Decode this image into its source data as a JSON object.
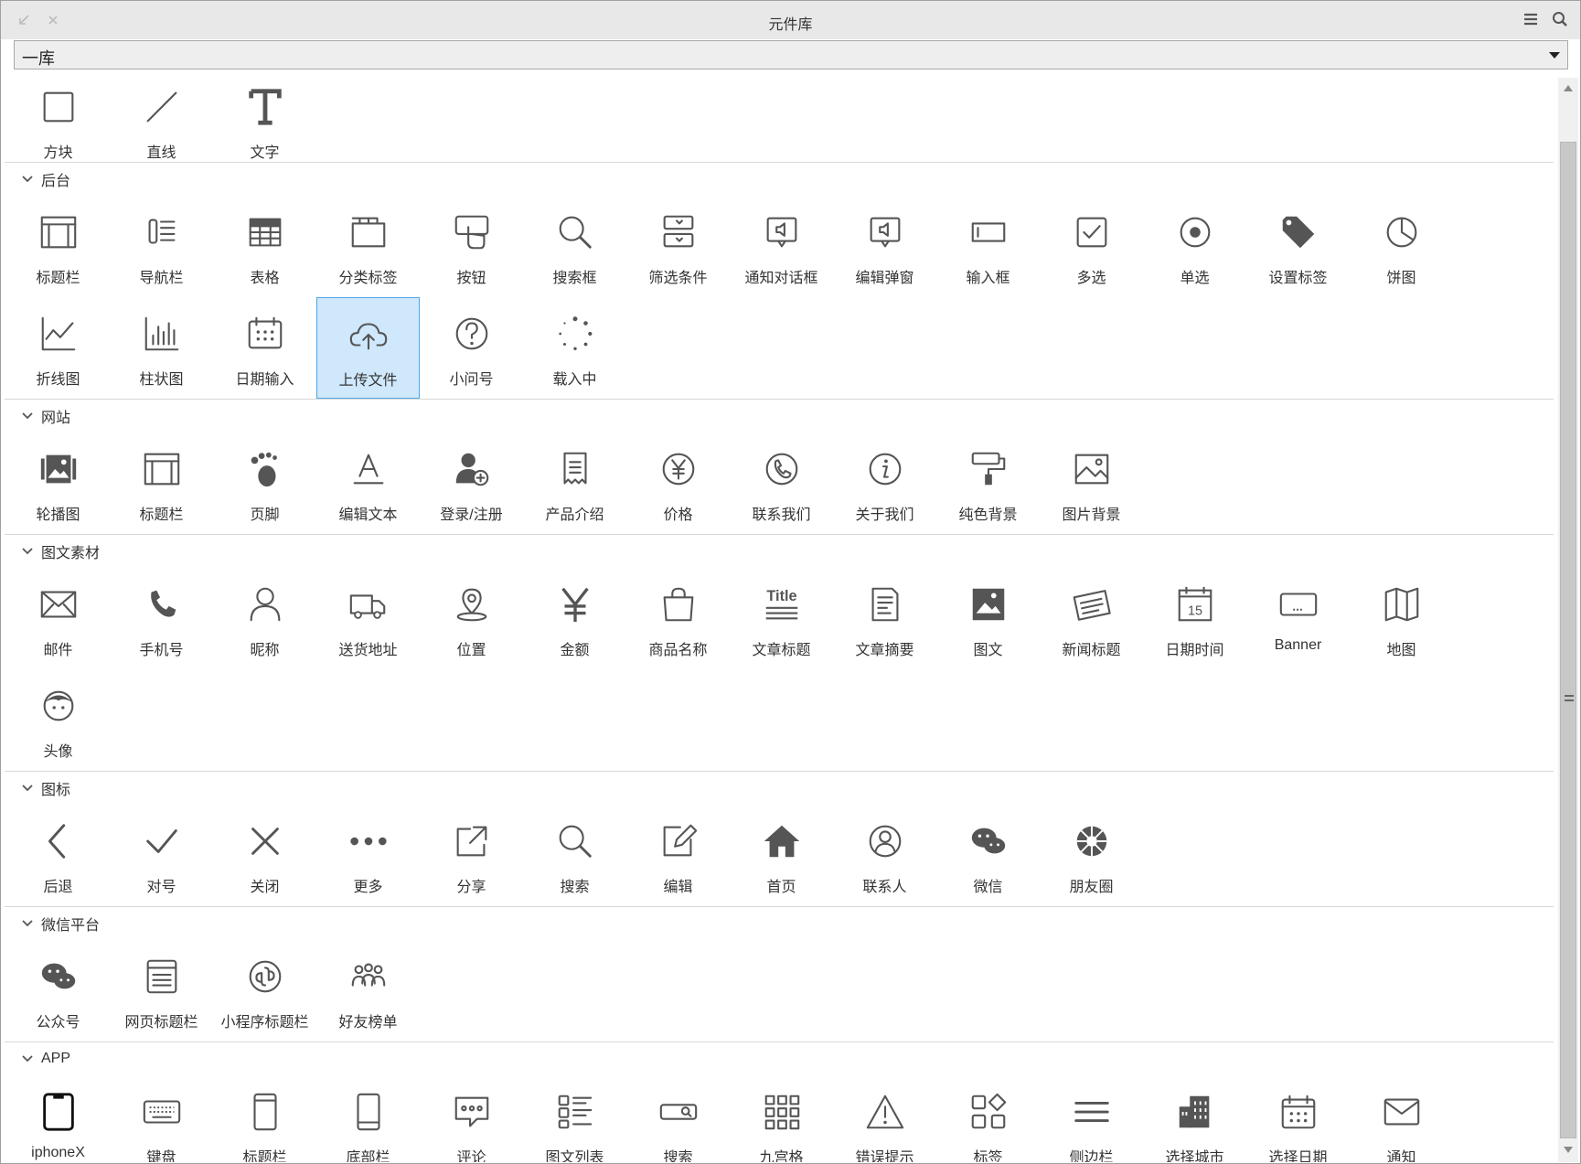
{
  "window": {
    "title": "元件库"
  },
  "library": {
    "selected": "一库"
  },
  "colors": {
    "accent": "#52a7e6",
    "selection_bg": "#cfe8fb",
    "icon": "#555555"
  },
  "basic": {
    "items": [
      {
        "label": "方块",
        "icon": "square-icon"
      },
      {
        "label": "直线",
        "icon": "line-icon"
      },
      {
        "label": "文字",
        "icon": "text-icon"
      }
    ]
  },
  "groups": [
    {
      "name": "后台",
      "items": [
        {
          "label": "标题栏",
          "icon": "titlebar-icon"
        },
        {
          "label": "导航栏",
          "icon": "navbar-icon"
        },
        {
          "label": "表格",
          "icon": "table-icon"
        },
        {
          "label": "分类标签",
          "icon": "category-tab-icon"
        },
        {
          "label": "按钮",
          "icon": "button-click-icon"
        },
        {
          "label": "搜索框",
          "icon": "search-icon"
        },
        {
          "label": "筛选条件",
          "icon": "filter-icon"
        },
        {
          "label": "通知对话框",
          "icon": "notify-dialog-icon"
        },
        {
          "label": "编辑弹窗",
          "icon": "edit-popup-icon"
        },
        {
          "label": "输入框",
          "icon": "input-box-icon"
        },
        {
          "label": "多选",
          "icon": "checkbox-icon"
        },
        {
          "label": "单选",
          "icon": "radio-icon"
        },
        {
          "label": "设置标签",
          "icon": "tag-icon"
        },
        {
          "label": "饼图",
          "icon": "pie-chart-icon"
        },
        {
          "label": "折线图",
          "icon": "line-chart-icon"
        },
        {
          "label": "柱状图",
          "icon": "bar-chart-icon"
        },
        {
          "label": "日期输入",
          "icon": "calendar-icon"
        },
        {
          "label": "上传文件",
          "icon": "cloud-upload-icon",
          "selected": true
        },
        {
          "label": "小问号",
          "icon": "question-icon"
        },
        {
          "label": "载入中",
          "icon": "loading-icon"
        }
      ]
    },
    {
      "name": "网站",
      "items": [
        {
          "label": "轮播图",
          "icon": "carousel-icon"
        },
        {
          "label": "标题栏",
          "icon": "titlebar-icon"
        },
        {
          "label": "页脚",
          "icon": "footprint-icon"
        },
        {
          "label": "编辑文本",
          "icon": "edit-text-icon"
        },
        {
          "label": "登录/注册",
          "icon": "user-add-icon"
        },
        {
          "label": "产品介绍",
          "icon": "product-icon"
        },
        {
          "label": "价格",
          "icon": "yen-circle-icon"
        },
        {
          "label": "联系我们",
          "icon": "phone-circle-icon"
        },
        {
          "label": "关于我们",
          "icon": "info-circle-icon"
        },
        {
          "label": "纯色背景",
          "icon": "paint-roller-icon"
        },
        {
          "label": "图片背景",
          "icon": "image-icon"
        }
      ]
    },
    {
      "name": "图文素材",
      "items": [
        {
          "label": "邮件",
          "icon": "mail-icon"
        },
        {
          "label": "手机号",
          "icon": "phone-icon"
        },
        {
          "label": "昵称",
          "icon": "person-icon"
        },
        {
          "label": "送货地址",
          "icon": "truck-icon"
        },
        {
          "label": "位置",
          "icon": "location-icon"
        },
        {
          "label": "金额",
          "icon": "yen-icon"
        },
        {
          "label": "商品名称",
          "icon": "shopping-bag-icon"
        },
        {
          "label": "文章标题",
          "icon": "title-text-icon",
          "glyph": "Title"
        },
        {
          "label": "文章摘要",
          "icon": "summary-icon"
        },
        {
          "label": "图文",
          "icon": "photo-text-icon"
        },
        {
          "label": "新闻标题",
          "icon": "newspaper-icon"
        },
        {
          "label": "日期时间",
          "icon": "calendar-date-icon",
          "glyph": "15"
        },
        {
          "label": "Banner",
          "icon": "banner-icon"
        },
        {
          "label": "地图",
          "icon": "map-icon"
        },
        {
          "label": "头像",
          "icon": "avatar-icon"
        }
      ]
    },
    {
      "name": "图标",
      "items": [
        {
          "label": "后退",
          "icon": "chevron-left-icon"
        },
        {
          "label": "对号",
          "icon": "check-icon"
        },
        {
          "label": "关闭",
          "icon": "close-icon"
        },
        {
          "label": "更多",
          "icon": "more-dots-icon"
        },
        {
          "label": "分享",
          "icon": "share-icon"
        },
        {
          "label": "搜索",
          "icon": "search-icon"
        },
        {
          "label": "编辑",
          "icon": "edit-icon"
        },
        {
          "label": "首页",
          "icon": "home-icon"
        },
        {
          "label": "联系人",
          "icon": "contact-icon"
        },
        {
          "label": "微信",
          "icon": "wechat-icon"
        },
        {
          "label": "朋友圈",
          "icon": "moments-icon"
        }
      ]
    },
    {
      "name": "微信平台",
      "items": [
        {
          "label": "公众号",
          "icon": "wechat-official-icon"
        },
        {
          "label": "网页标题栏",
          "icon": "webpage-title-icon"
        },
        {
          "label": "小程序标题栏",
          "icon": "mini-program-icon"
        },
        {
          "label": "好友榜单",
          "icon": "friends-rank-icon"
        }
      ]
    },
    {
      "name": "APP",
      "items": [
        {
          "label": "iphoneX",
          "icon": "iphonex-icon"
        },
        {
          "label": "键盘",
          "icon": "keyboard-icon"
        },
        {
          "label": "标题栏",
          "icon": "phone-titlebar-icon"
        },
        {
          "label": "底部栏",
          "icon": "phone-bottombar-icon"
        },
        {
          "label": "评论",
          "icon": "comment-icon"
        },
        {
          "label": "图文列表",
          "icon": "list-icon"
        },
        {
          "label": "搜索",
          "icon": "search-bar-icon"
        },
        {
          "label": "九宫格",
          "icon": "grid-nine-icon"
        },
        {
          "label": "错误提示",
          "icon": "warning-icon"
        },
        {
          "label": "标签",
          "icon": "shapes-icon"
        },
        {
          "label": "侧边栏",
          "icon": "menu-lines-icon"
        },
        {
          "label": "选择城市",
          "icon": "building-icon"
        },
        {
          "label": "选择日期",
          "icon": "calendar-grid-icon"
        },
        {
          "label": "通知",
          "icon": "envelope-icon"
        }
      ]
    }
  ]
}
